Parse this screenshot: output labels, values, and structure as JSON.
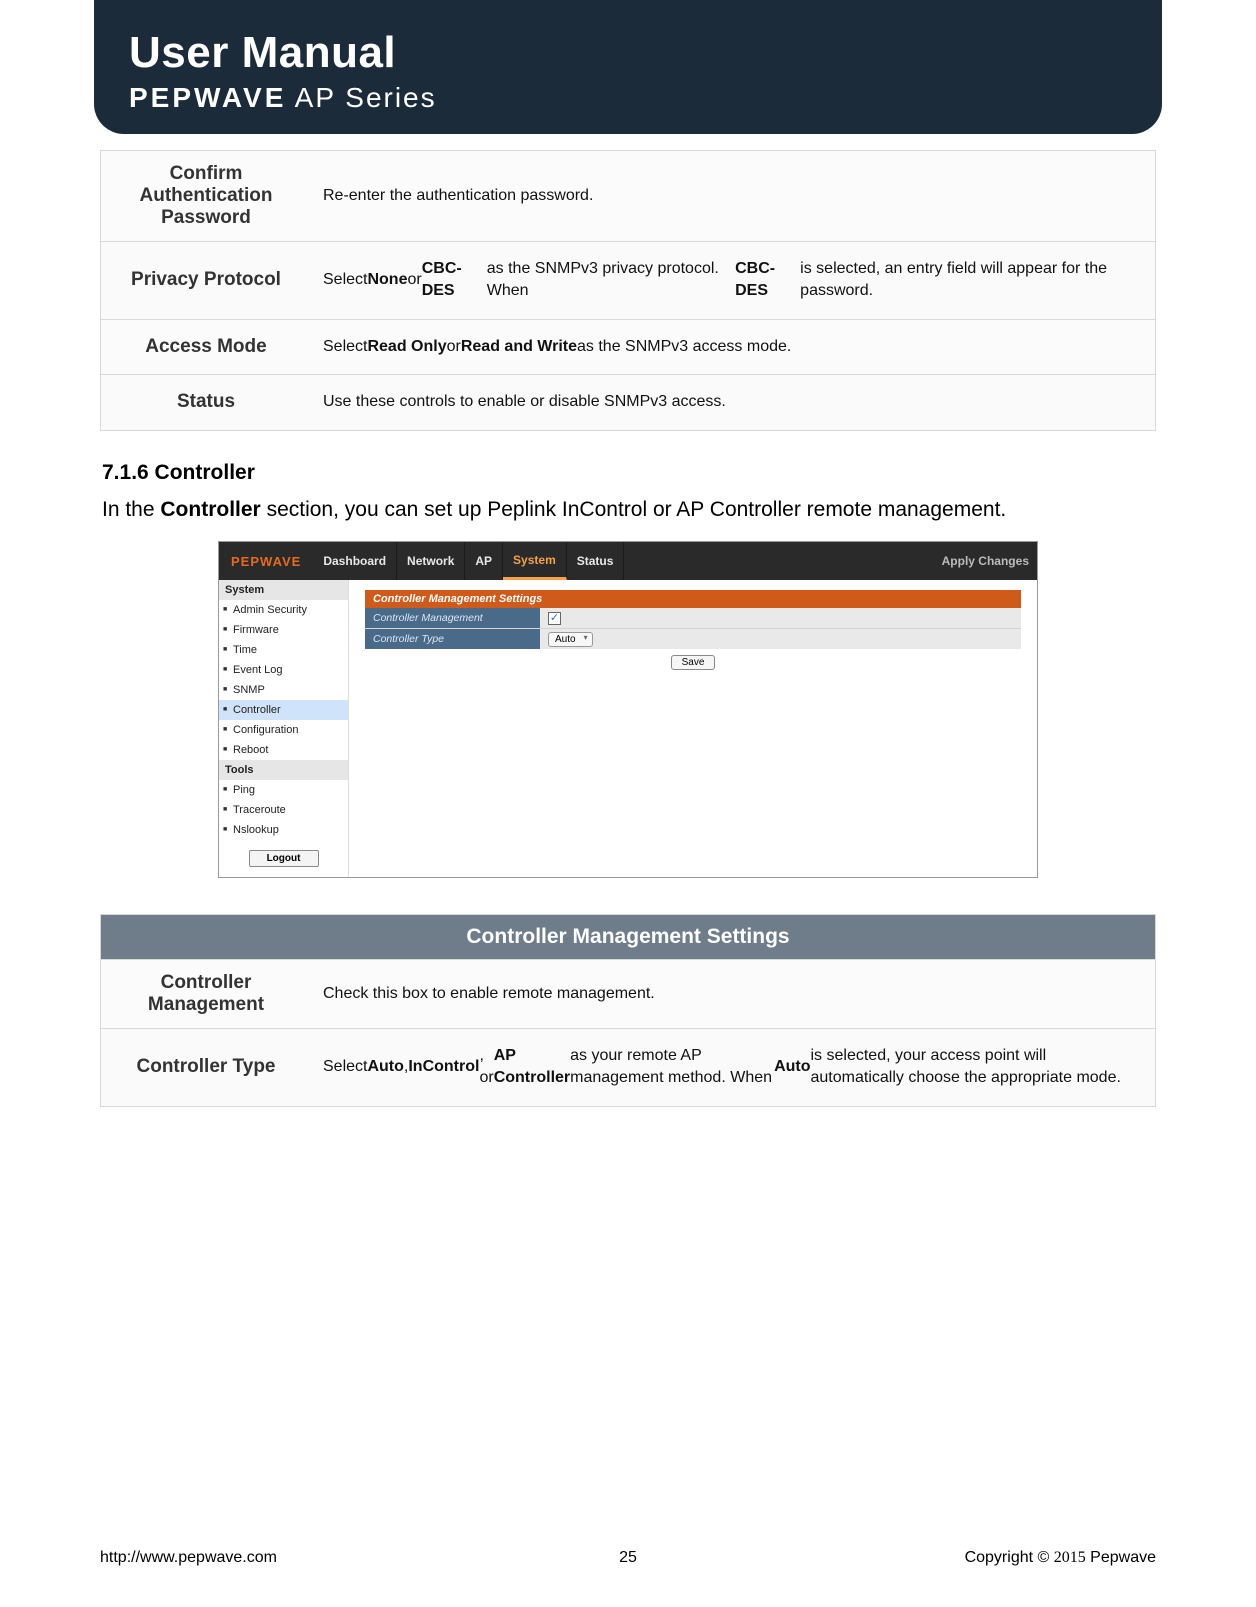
{
  "header": {
    "line1": "User Manual",
    "brand": "PEPWAVE",
    "series": " AP Series"
  },
  "table1": {
    "rows": [
      {
        "label": "Confirm Authentication Password",
        "desc_html": "Re-enter the authentication password."
      },
      {
        "label": "Privacy Protocol",
        "desc_html": "Select <b>None</b> or <b>CBC-DES</b> as the SNMPv3 privacy protocol. When <b>CBC-DES</b> is selected, an entry field will appear for the password."
      },
      {
        "label": "Access Mode",
        "desc_html": "Select <b>Read Only</b> or <b>Read and Write</b> as the SNMPv3 access mode."
      },
      {
        "label": "Status",
        "desc_html": "Use these controls to enable or disable SNMPv3 access."
      }
    ]
  },
  "section": {
    "heading": "7.1.6   Controller",
    "para_html": "In the <b>Controller</b> section, you can set up Peplink InControl or AP Controller remote management."
  },
  "ui": {
    "brand": "PEPWAVE",
    "tabs": [
      {
        "label": "Dashboard",
        "active": false
      },
      {
        "label": "Network",
        "active": false
      },
      {
        "label": "AP",
        "active": false
      },
      {
        "label": "System",
        "active": true
      },
      {
        "label": "Status",
        "active": false
      }
    ],
    "apply": "Apply Changes",
    "side": {
      "group1": {
        "title": "System",
        "items": [
          "Admin Security",
          "Firmware",
          "Time",
          "Event Log",
          "SNMP",
          "Controller",
          "Configuration",
          "Reboot"
        ],
        "highlight": "Controller"
      },
      "group2": {
        "title": "Tools",
        "items": [
          "Ping",
          "Traceroute",
          "Nslookup"
        ]
      },
      "logout": "Logout"
    },
    "form": {
      "title": "Controller Management Settings",
      "rows": [
        {
          "label": "Controller Management",
          "type": "checkbox",
          "checked": true
        },
        {
          "label": "Controller Type",
          "type": "select",
          "value": "Auto"
        }
      ],
      "save": "Save"
    }
  },
  "table2": {
    "title": "Controller Management Settings",
    "rows": [
      {
        "label": "Controller Management",
        "desc_html": "Check this box to enable remote management."
      },
      {
        "label": "Controller Type",
        "desc_html": "Select <b>Auto</b>, <b>InControl</b>, or <b>AP Controller</b> as your remote AP management method. When <b>Auto</b> is selected, your access point will automatically choose the appropriate mode."
      }
    ]
  },
  "footer": {
    "url": "http://www.pepwave.com",
    "page": "25",
    "copyright_prefix": "Copyright  ©  ",
    "copyright_year": "2015",
    "copyright_suffix": "  Pepwave"
  }
}
